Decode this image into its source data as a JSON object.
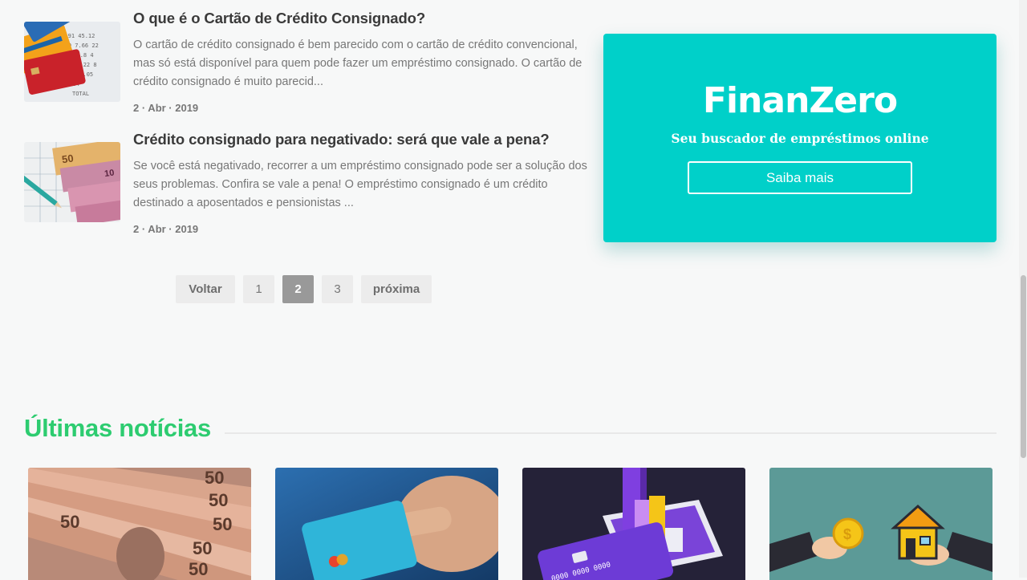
{
  "articles": [
    {
      "title": "O que é o Cartão de Crédito Consignado?",
      "excerpt": "O cartão de crédito consignado é bem parecido com o cartão de crédito convencional, mas só está disponível para quem pode fazer um empréstimo consignado. O cartão de crédito consignado é muito parecid...",
      "date": "2 · Abr · 2019"
    },
    {
      "title": "Crédito consignado para negativado: será que vale a pena?",
      "excerpt": "Se você está negativado, recorrer a um empréstimo consignado pode ser a solução dos seus problemas. Confira se vale a pena! O empréstimo consignado é um crédito destinado a aposentados e pensionistas ...",
      "date": "2 · Abr · 2019"
    }
  ],
  "ad": {
    "logo": "FinanZero",
    "tagline": "Seu buscador de empréstimos online",
    "button_label": "Saiba mais",
    "color": "#00d0c9"
  },
  "pagination": {
    "back": "Voltar",
    "pages": [
      "1",
      "2",
      "3"
    ],
    "current": "2",
    "next": "próxima"
  },
  "latest": {
    "title": "Últimas notícias",
    "accent": "#2dcc70",
    "cards": [
      {
        "image": "banknotes-image"
      },
      {
        "image": "credit-card-hand-image"
      },
      {
        "image": "phone-chart-image"
      },
      {
        "image": "house-coin-hands-image"
      }
    ]
  }
}
